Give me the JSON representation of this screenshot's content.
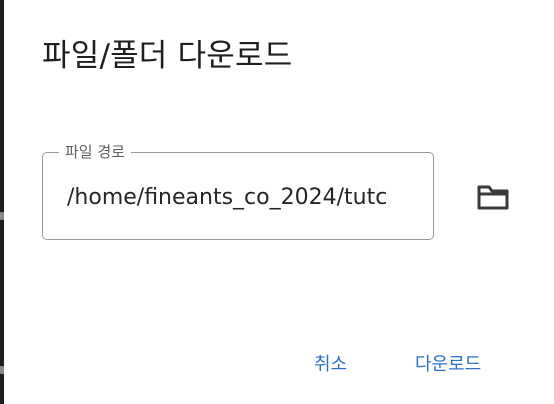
{
  "dialog": {
    "title": "파일/폴더 다운로드"
  },
  "path_field": {
    "label": "파일 경로",
    "value": "/home/fineants_co_2024/tutc"
  },
  "icons": {
    "browse": "folder-icon"
  },
  "actions": {
    "cancel_label": "취소",
    "download_label": "다운로드"
  },
  "colors": {
    "accent": "#2f6fd0",
    "title": "#1f1f1f",
    "border": "#9a9a9a"
  }
}
